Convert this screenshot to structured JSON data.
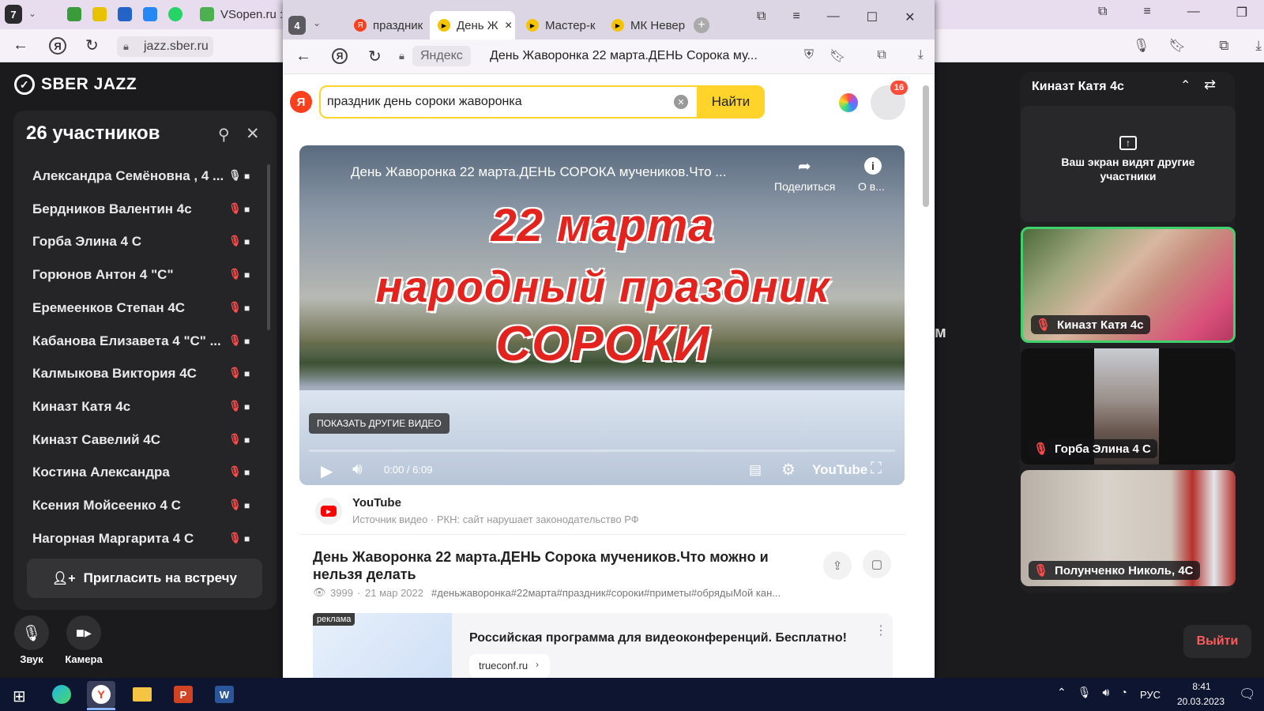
{
  "outer_browser": {
    "tab_count_badge": "7",
    "active_tab_title": "VSopen.ru ::",
    "url": "jazz.sber.ru"
  },
  "sberjazz": {
    "logo_text": "SBER JAZZ",
    "participants_title": "26 участников",
    "participants": [
      {
        "name": "Александра Семёновна , 4 ...",
        "mic": "on"
      },
      {
        "name": "Бердников Валентин 4с",
        "mic": "off"
      },
      {
        "name": "Горба Элина 4 С",
        "mic": "off"
      },
      {
        "name": "Горюнов Антон 4 \"С\"",
        "mic": "off"
      },
      {
        "name": "Еремеенков Степан 4С",
        "mic": "off"
      },
      {
        "name": "Кабанова Елизавета 4 \"С\" ...",
        "mic": "off"
      },
      {
        "name": "Калмыкова Виктория 4С",
        "mic": "off"
      },
      {
        "name": "Киназт Катя 4с",
        "mic": "off"
      },
      {
        "name": "Киназт Савелий 4С",
        "mic": "off"
      },
      {
        "name": "Костина Александра",
        "mic": "off"
      },
      {
        "name": "Ксения Мойсеенко 4 С",
        "mic": "off"
      },
      {
        "name": "Нагорная Маргарита 4 С",
        "mic": "off"
      }
    ],
    "invite_label": "Пригласить на встречу",
    "sound_label": "Звук",
    "camera_label": "Камера",
    "speaker_title": "Киназт Катя 4с",
    "screen_share_notice": "Ваш экран видят другие участники",
    "tiles": [
      {
        "name": "Киназт Катя 4с"
      },
      {
        "name": "Горба Элина 4 С"
      },
      {
        "name": "Полунченко Николь, 4С"
      }
    ],
    "exit_label": "Выйти",
    "partial_letter": "м"
  },
  "inner_browser": {
    "tab_count_badge": "4",
    "tabs": [
      {
        "label": "праздник"
      },
      {
        "label": "День Ж"
      },
      {
        "label": "Мастер-к"
      },
      {
        "label": "МК Невер"
      }
    ],
    "site_label": "Яндекс",
    "page_title": "День Жаворонка 22 марта.ДЕНЬ Сорока му...",
    "search_query": "праздник день сороки жаворонка",
    "search_button": "Найти",
    "notification_count": "16"
  },
  "video": {
    "title": "День Жаворонка 22 марта.ДЕНЬ СОРОКА мучеников.Что ...",
    "share_label": "Поделиться",
    "info_label": "О в...",
    "overlay_line1": "22 марта",
    "overlay_line2": "народный праздник",
    "overlay_line3": "СОРОКИ",
    "more_videos": "ПОКАЗАТЬ ДРУГИЕ ВИДЕО",
    "time": "0:00 / 6:09",
    "progress": 0,
    "brand": "YouTube"
  },
  "result": {
    "source_name": "YouTube",
    "source_desc": "Источник видео · РКН: сайт нарушает законодательство РФ",
    "title": "День Жаворонка 22 марта.ДЕНЬ Сорока мучеников.Что можно и нельзя делать",
    "views": "3999",
    "date": "21 мар 2022",
    "tags": "#деньжаворонка#22марта#праздник#сороки#приметы#обрядыМой кан..."
  },
  "ad": {
    "badge": "реклама",
    "title": "Российская программа для видеоконференций. Бесплатно!",
    "link": "trueconf.ru"
  },
  "taskbar": {
    "lang": "РУС",
    "time": "8:41",
    "date": "20.03.2023"
  },
  "colors": {
    "yandex_yellow": "#fed42b",
    "youtube_red": "#ff0000",
    "mic_off_red": "#ff4d4d",
    "active_speaker_green": "#3fd16b"
  }
}
